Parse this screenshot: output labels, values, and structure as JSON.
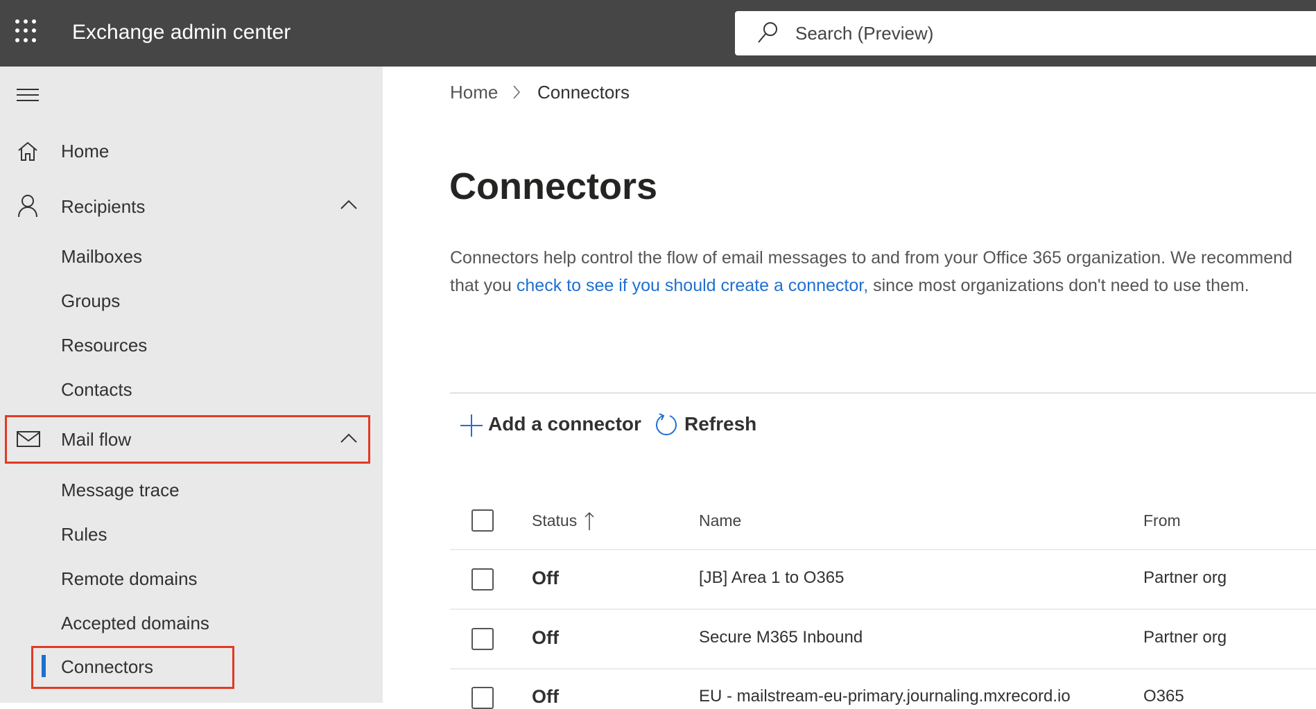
{
  "app": {
    "title": "Exchange admin center",
    "search_placeholder": "Search (Preview)"
  },
  "sidebar": {
    "items": [
      {
        "label": "Home"
      },
      {
        "label": "Recipients"
      },
      {
        "label": "Mailboxes"
      },
      {
        "label": "Groups"
      },
      {
        "label": "Resources"
      },
      {
        "label": "Contacts"
      },
      {
        "label": "Mail flow"
      },
      {
        "label": "Message trace"
      },
      {
        "label": "Rules"
      },
      {
        "label": "Remote domains"
      },
      {
        "label": "Accepted domains"
      },
      {
        "label": "Connectors"
      }
    ]
  },
  "breadcrumb": {
    "home": "Home",
    "current": "Connectors"
  },
  "page": {
    "title": "Connectors",
    "desc_pre": "Connectors help control the flow of email messages to and from your Office 365 organization. We recommend that you ",
    "desc_link": "check to see if you should create a connector,",
    "desc_post": " since most organizations don't need to use them."
  },
  "toolbar": {
    "add": "Add a connector",
    "refresh": "Refresh"
  },
  "table": {
    "headers": {
      "status": "Status",
      "name": "Name",
      "from": "From"
    },
    "rows": [
      {
        "status": "Off",
        "name": "[JB] Area 1 to O365",
        "from": "Partner org"
      },
      {
        "status": "Off",
        "name": "Secure M365 Inbound",
        "from": "Partner org"
      },
      {
        "status": "Off",
        "name": "EU - mailstream-eu-primary.journaling.mxrecord.io",
        "from": "O365"
      }
    ]
  }
}
